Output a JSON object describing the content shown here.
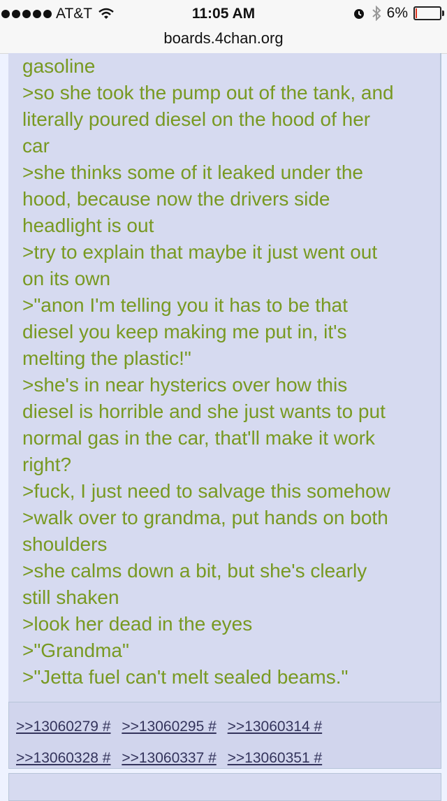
{
  "status_bar": {
    "carrier": "AT&T",
    "time": "11:05 AM",
    "battery": "6%",
    "battery_level": 0.06,
    "battery_color": "#e0341f",
    "icons": [
      "signal-dots-icon",
      "wifi-icon",
      "alarm-icon",
      "bluetooth-icon",
      "battery-icon"
    ]
  },
  "browser": {
    "url": "boards.4chan.org"
  },
  "colors": {
    "greentext": "#789922",
    "post_bg": "#d6daf0",
    "link": "#34345c"
  },
  "post": {
    "lines": [
      "gasoline",
      ">so she took the pump out of the tank, and",
      "literally poured diesel on the hood of her",
      "car",
      ">she thinks some of it leaked under the",
      "hood, because now the drivers side",
      "headlight is out",
      ">try to explain that maybe it just went out",
      "on its own",
      ">\"anon I'm telling you it has to be that",
      "diesel you keep making me put in, it's",
      "melting the plastic!\"",
      ">she's in near hysterics over how this",
      "diesel is horrible and she just wants to put",
      "normal gas in the car, that'll make it work",
      "right?",
      ">fuck, I just need to salvage this somehow",
      ">walk over to grandma, put hands on both",
      "shoulders",
      ">she calms down a bit, but she's clearly",
      "still shaken",
      ">look her dead in the eyes",
      ">\"Grandma\"",
      ">\"Jetta fuel can't melt sealed beams.\""
    ]
  },
  "replies": [
    ">>13060279 #",
    ">>13060295 #",
    ">>13060314 #",
    ">>13060328 #",
    ">>13060337 #",
    ">>13060351 #"
  ]
}
